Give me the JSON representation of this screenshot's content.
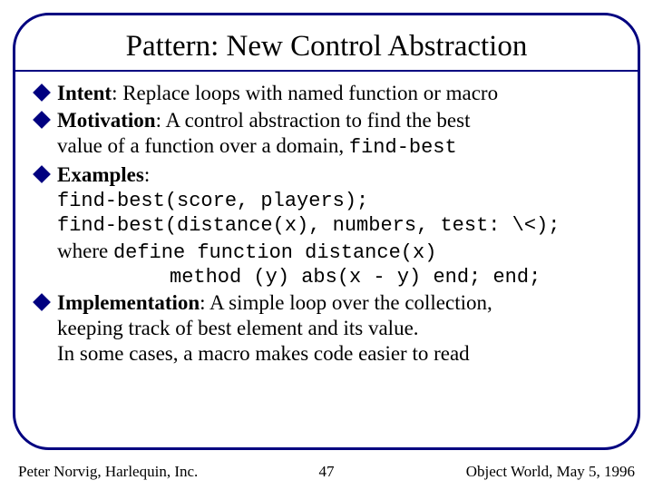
{
  "title": "Pattern: New Control Abstraction",
  "bullets": {
    "intent_label": "Intent",
    "intent_text": ": Replace loops with named function or macro",
    "motivation_label": "Motivation",
    "motivation_text_a": ": A control abstraction to find the best",
    "motivation_text_b": "value of a function over a domain, ",
    "motivation_code": "find-best",
    "examples_label": "Examples",
    "examples_colon": ":",
    "ex_line1": "find-best(score, players);",
    "ex_line2": "find-best(distance(x), numbers, test: \\<);",
    "where_word": "where ",
    "where_code": "define function distance(x)",
    "where_line2": "method (y) abs(x - y) end; end;",
    "impl_label": "Implementation",
    "impl_text_a": ": A simple loop over the collection,",
    "impl_text_b": "keeping track of best element and its value.",
    "impl_text_c": "In some cases, a macro makes code easier to read"
  },
  "footer": {
    "left": "Peter Norvig, Harlequin, Inc.",
    "center": "47",
    "right": "Object World, May 5, 1996"
  }
}
